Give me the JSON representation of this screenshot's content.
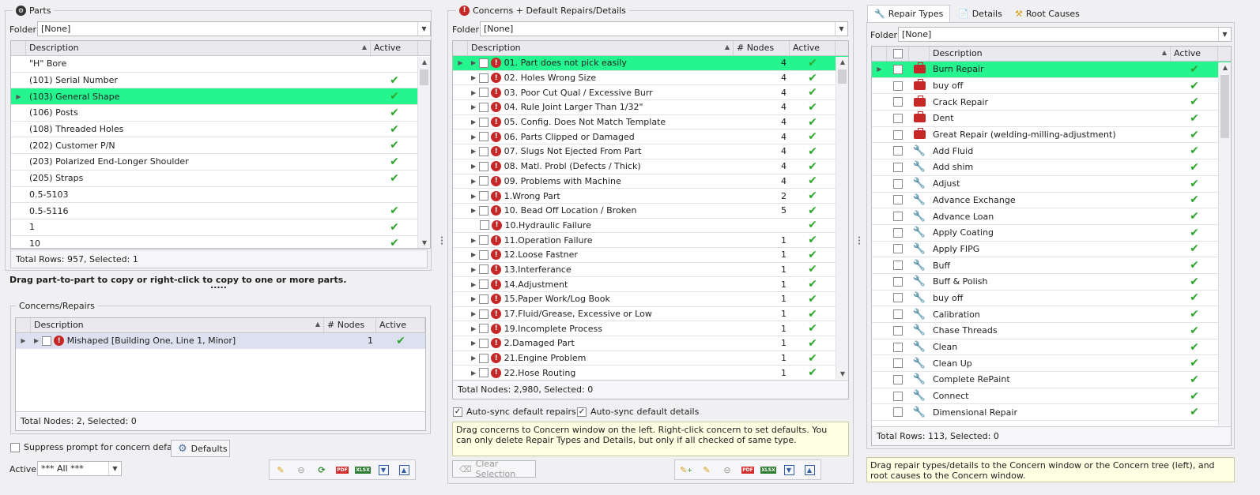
{
  "parts": {
    "title": "Parts",
    "folder_label": "Folder",
    "folder_value": "[None]",
    "col_description": "Description",
    "col_active": "Active",
    "rows": [
      {
        "d": "\"H\" Bore",
        "a": ""
      },
      {
        "d": "(101) Serial Number",
        "a": "✔"
      },
      {
        "d": "(103) General Shape",
        "a": "✔"
      },
      {
        "d": "(106) Posts",
        "a": "✔"
      },
      {
        "d": "(108) Threaded Holes",
        "a": "✔"
      },
      {
        "d": "(202) Customer P/N",
        "a": "✔"
      },
      {
        "d": "(203) Polarized End-Longer Shoulder",
        "a": "✔"
      },
      {
        "d": "(205) Straps",
        "a": "✔"
      },
      {
        "d": "0.5-5103",
        "a": ""
      },
      {
        "d": "0.5-5116",
        "a": "✔"
      },
      {
        "d": "1",
        "a": "✔"
      },
      {
        "d": "10",
        "a": "✔"
      }
    ],
    "total": "Total Rows: 957, Selected: 1",
    "drag_hint": "Drag part-to-part to copy or right-click to copy to one or more parts.",
    "grip": "....."
  },
  "concerns_repairs": {
    "title": "Concerns/Repairs",
    "col_description": "Description",
    "col_nodes": "# Nodes",
    "col_active": "Active",
    "rows": [
      {
        "d": "Mishaped [Building One, Line 1, Minor]",
        "n": "1",
        "a": "✔"
      }
    ],
    "total": "Total Nodes: 2, Selected: 0",
    "suppress_label": "Suppress prompt for concern defaults",
    "defaults_label": "Defaults",
    "active_label": "Active",
    "active_value": "*** All ***"
  },
  "concerns": {
    "title": "Concerns + Default Repairs/Details",
    "folder_label": "Folder",
    "folder_value": "[None]",
    "col_description": "Description",
    "col_nodes": "# Nodes",
    "col_active": "Active",
    "rows": [
      {
        "d": "01. Part does not pick easily",
        "n": "4",
        "a": "✔"
      },
      {
        "d": "02. Holes Wrong Size",
        "n": "4",
        "a": "✔"
      },
      {
        "d": "03. Poor Cut Qual / Excessive Burr",
        "n": "4",
        "a": "✔"
      },
      {
        "d": "04. Rule Joint Larger Than 1/32\"",
        "n": "4",
        "a": "✔"
      },
      {
        "d": "05. Config. Does Not Match Template",
        "n": "4",
        "a": "✔"
      },
      {
        "d": "06. Parts Clipped or Damaged",
        "n": "4",
        "a": "✔"
      },
      {
        "d": "07. Slugs Not Ejected From Part",
        "n": "4",
        "a": "✔"
      },
      {
        "d": "08. Matl. Probl (Defects / Thick)",
        "n": "4",
        "a": "✔"
      },
      {
        "d": "09. Problems with Machine",
        "n": "4",
        "a": "✔"
      },
      {
        "d": "1.Wrong Part",
        "n": "2",
        "a": "✔"
      },
      {
        "d": "10. Bead Off Location / Broken",
        "n": "5",
        "a": "✔"
      },
      {
        "d": "10.Hydraulic Failure",
        "n": "",
        "a": "✔"
      },
      {
        "d": "11.Operation Failure",
        "n": "1",
        "a": "✔"
      },
      {
        "d": "12.Loose Fastner",
        "n": "1",
        "a": "✔"
      },
      {
        "d": "13.Interferance",
        "n": "1",
        "a": "✔"
      },
      {
        "d": "14.Adjustment",
        "n": "1",
        "a": "✔"
      },
      {
        "d": "15.Paper Work/Log Book",
        "n": "1",
        "a": "✔"
      },
      {
        "d": "17.Fluid/Grease, Excessive or Low",
        "n": "1",
        "a": "✔"
      },
      {
        "d": "19.Incomplete Process",
        "n": "1",
        "a": "✔"
      },
      {
        "d": "2.Damaged Part",
        "n": "1",
        "a": "✔"
      },
      {
        "d": "21.Engine Problem",
        "n": "1",
        "a": "✔"
      },
      {
        "d": "22.Hose Routing",
        "n": "1",
        "a": "✔"
      }
    ],
    "total": "Total Nodes: 2,980, Selected: 0",
    "autosync_repairs": "Auto-sync default repairs",
    "autosync_details": "Auto-sync default details",
    "info": "Drag concerns to Concern window on the left. Right-click concern to set defaults. You can only delete Repair Types and Details, but only if all checked of same type.",
    "clear_selection": "Clear Selection"
  },
  "repairs": {
    "tabs": [
      "Repair Types",
      "Details",
      "Root Causes"
    ],
    "folder_label": "Folder",
    "folder_value": "[None]",
    "col_description": "Description",
    "col_active": "Active",
    "rows": [
      {
        "d": "Burn Repair",
        "k": "kit",
        "a": "✔"
      },
      {
        "d": "buy off",
        "k": "kit",
        "a": "✔"
      },
      {
        "d": "Crack Repair",
        "k": "kit",
        "a": "✔"
      },
      {
        "d": "Dent",
        "k": "kit",
        "a": "✔"
      },
      {
        "d": "Great Repair (welding-milling-adjustment)",
        "k": "kit",
        "a": "✔"
      },
      {
        "d": "Add Fluid",
        "k": "wrench",
        "a": "✔"
      },
      {
        "d": "Add shim",
        "k": "wrench",
        "a": "✔"
      },
      {
        "d": "Adjust",
        "k": "wrench",
        "a": "✔"
      },
      {
        "d": "Advance Exchange",
        "k": "wrench",
        "a": "✔"
      },
      {
        "d": "Advance Loan",
        "k": "wrench",
        "a": "✔"
      },
      {
        "d": "Apply Coating",
        "k": "wrench",
        "a": "✔"
      },
      {
        "d": "Apply FIPG",
        "k": "wrench",
        "a": "✔"
      },
      {
        "d": "Buff",
        "k": "wrench",
        "a": "✔"
      },
      {
        "d": "Buff & Polish",
        "k": "wrench",
        "a": "✔"
      },
      {
        "d": "buy off",
        "k": "wrench",
        "a": "✔"
      },
      {
        "d": "Calibration",
        "k": "wrench",
        "a": "✔"
      },
      {
        "d": "Chase Threads",
        "k": "wrench",
        "a": "✔"
      },
      {
        "d": "Clean",
        "k": "wrench",
        "a": "✔"
      },
      {
        "d": "Clean Up",
        "k": "wrench",
        "a": "✔"
      },
      {
        "d": "Complete RePaint",
        "k": "wrench",
        "a": "✔"
      },
      {
        "d": "Connect",
        "k": "wrench",
        "a": "✔"
      },
      {
        "d": "Dimensional Repair",
        "k": "wrench",
        "a": "✔"
      }
    ],
    "total": "Total Rows: 113, Selected: 0",
    "info": "Drag repair types/details to the Concern window or the Concern tree (left), and root causes to the Concern window."
  },
  "colors": {
    "selected_row": "#24f58f",
    "error_red": "#c62828",
    "check_green": "#2ea62e"
  }
}
